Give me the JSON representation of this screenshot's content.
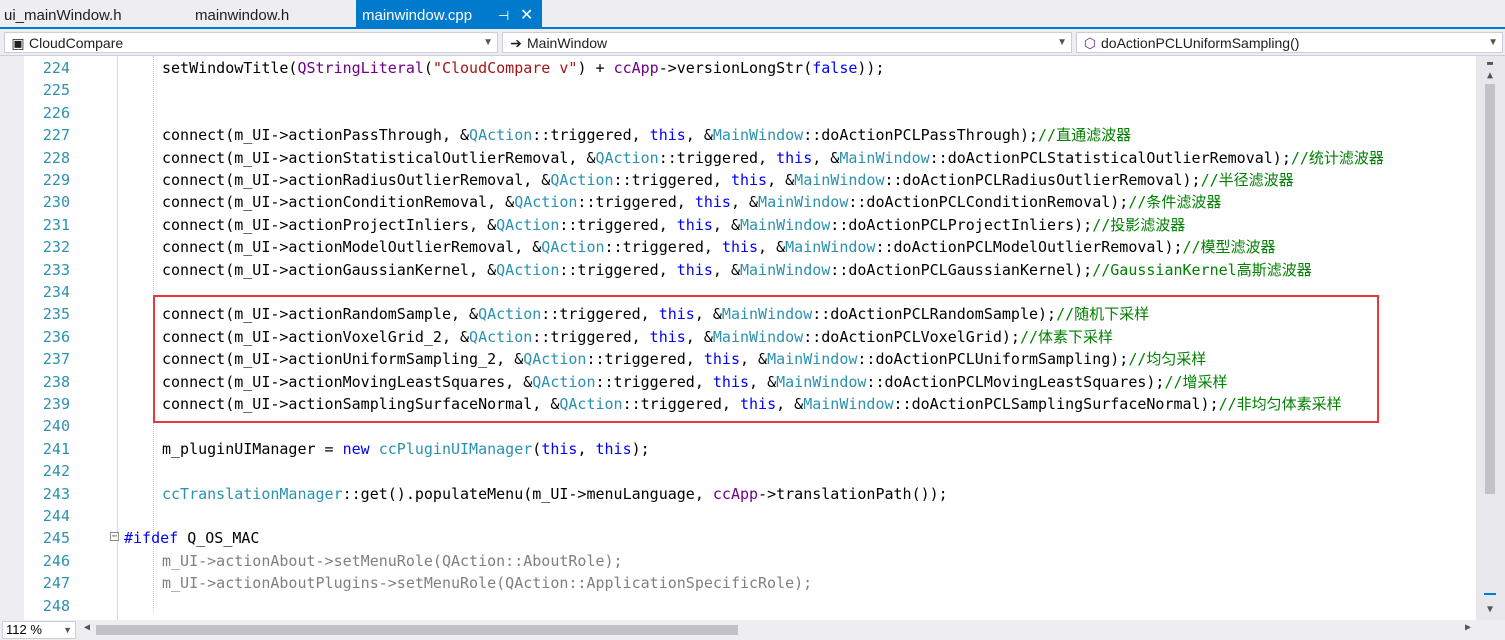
{
  "tabs": [
    {
      "label": "ui_mainWindow.h",
      "active": false
    },
    {
      "label": "mainwindow.h",
      "active": false
    },
    {
      "label": "mainwindow.cpp",
      "active": true
    }
  ],
  "tab_icons": {
    "pin": "pin-icon",
    "close": "close-icon"
  },
  "nav": {
    "project": "CloudCompare",
    "scope": "MainWindow",
    "member": "doActionPCLUniformSampling()"
  },
  "zoom": "112 %",
  "colors": {
    "accent": "#007acc",
    "line_number": "#2b91af",
    "keyword": "#0000ff",
    "type": "#2b91af",
    "macro": "#6f008a",
    "string": "#a31515",
    "comment": "#008000",
    "highlight_box": "#e8383d"
  },
  "code_lines": [
    {
      "n": "224",
      "segs": [
        [
          "p",
          "setWindowTitle("
        ],
        [
          "mc",
          "QStringLiteral"
        ],
        [
          "p",
          "("
        ],
        [
          "st",
          "\"CloudCompare v\""
        ],
        [
          "p",
          ") + "
        ],
        [
          "mc",
          "ccApp"
        ],
        [
          "p",
          "->versionLongStr("
        ],
        [
          "kw",
          "false"
        ],
        [
          "p",
          "));"
        ]
      ]
    },
    {
      "n": "225",
      "segs": []
    },
    {
      "n": "226",
      "segs": []
    },
    {
      "n": "227",
      "segs": [
        [
          "p",
          "connect(m_UI->actionPassThrough, &"
        ],
        [
          "ty",
          "QAction"
        ],
        [
          "p",
          "::triggered, "
        ],
        [
          "kw",
          "this"
        ],
        [
          "p",
          ", &"
        ],
        [
          "ty",
          "MainWindow"
        ],
        [
          "p",
          "::doActionPCLPassThrough);"
        ],
        [
          "cm",
          "//直通滤波器"
        ]
      ]
    },
    {
      "n": "228",
      "segs": [
        [
          "p",
          "connect(m_UI->actionStatisticalOutlierRemoval, &"
        ],
        [
          "ty",
          "QAction"
        ],
        [
          "p",
          "::triggered, "
        ],
        [
          "kw",
          "this"
        ],
        [
          "p",
          ", &"
        ],
        [
          "ty",
          "MainWindow"
        ],
        [
          "p",
          "::doActionPCLStatisticalOutlierRemoval);"
        ],
        [
          "cm",
          "//统计滤波器"
        ]
      ]
    },
    {
      "n": "229",
      "segs": [
        [
          "p",
          "connect(m_UI->actionRadiusOutlierRemoval, &"
        ],
        [
          "ty",
          "QAction"
        ],
        [
          "p",
          "::triggered, "
        ],
        [
          "kw",
          "this"
        ],
        [
          "p",
          ", &"
        ],
        [
          "ty",
          "MainWindow"
        ],
        [
          "p",
          "::doActionPCLRadiusOutlierRemoval);"
        ],
        [
          "cm",
          "//半径滤波器"
        ]
      ]
    },
    {
      "n": "230",
      "segs": [
        [
          "p",
          "connect(m_UI->actionConditionRemoval, &"
        ],
        [
          "ty",
          "QAction"
        ],
        [
          "p",
          "::triggered, "
        ],
        [
          "kw",
          "this"
        ],
        [
          "p",
          ", &"
        ],
        [
          "ty",
          "MainWindow"
        ],
        [
          "p",
          "::doActionPCLConditionRemoval);"
        ],
        [
          "cm",
          "//条件滤波器"
        ]
      ]
    },
    {
      "n": "231",
      "segs": [
        [
          "p",
          "connect(m_UI->actionProjectInliers, &"
        ],
        [
          "ty",
          "QAction"
        ],
        [
          "p",
          "::triggered, "
        ],
        [
          "kw",
          "this"
        ],
        [
          "p",
          ", &"
        ],
        [
          "ty",
          "MainWindow"
        ],
        [
          "p",
          "::doActionPCLProjectInliers);"
        ],
        [
          "cm",
          "//投影滤波器"
        ]
      ]
    },
    {
      "n": "232",
      "segs": [
        [
          "p",
          "connect(m_UI->actionModelOutlierRemoval, &"
        ],
        [
          "ty",
          "QAction"
        ],
        [
          "p",
          "::triggered, "
        ],
        [
          "kw",
          "this"
        ],
        [
          "p",
          ", &"
        ],
        [
          "ty",
          "MainWindow"
        ],
        [
          "p",
          "::doActionPCLModelOutlierRemoval);"
        ],
        [
          "cm",
          "//模型滤波器"
        ]
      ]
    },
    {
      "n": "233",
      "segs": [
        [
          "p",
          "connect(m_UI->actionGaussianKernel, &"
        ],
        [
          "ty",
          "QAction"
        ],
        [
          "p",
          "::triggered, "
        ],
        [
          "kw",
          "this"
        ],
        [
          "p",
          ", &"
        ],
        [
          "ty",
          "MainWindow"
        ],
        [
          "p",
          "::doActionPCLGaussianKernel);"
        ],
        [
          "cm",
          "//GaussianKernel高斯滤波器"
        ]
      ]
    },
    {
      "n": "234",
      "segs": []
    },
    {
      "n": "235",
      "segs": [
        [
          "p",
          "connect(m_UI->actionRandomSample, &"
        ],
        [
          "ty",
          "QAction"
        ],
        [
          "p",
          "::triggered, "
        ],
        [
          "kw",
          "this"
        ],
        [
          "p",
          ", &"
        ],
        [
          "ty",
          "MainWindow"
        ],
        [
          "p",
          "::doActionPCLRandomSample);"
        ],
        [
          "cm",
          "//随机下采样"
        ]
      ]
    },
    {
      "n": "236",
      "segs": [
        [
          "p",
          "connect(m_UI->actionVoxelGrid_2, &"
        ],
        [
          "ty",
          "QAction"
        ],
        [
          "p",
          "::triggered, "
        ],
        [
          "kw",
          "this"
        ],
        [
          "p",
          ", &"
        ],
        [
          "ty",
          "MainWindow"
        ],
        [
          "p",
          "::doActionPCLVoxelGrid);"
        ],
        [
          "cm",
          "//体素下采样"
        ]
      ]
    },
    {
      "n": "237",
      "segs": [
        [
          "p",
          "connect(m_UI->actionUniformSampling_2, &"
        ],
        [
          "ty",
          "QAction"
        ],
        [
          "p",
          "::triggered, "
        ],
        [
          "kw",
          "this"
        ],
        [
          "p",
          ", &"
        ],
        [
          "ty",
          "MainWindow"
        ],
        [
          "p",
          "::doActionPCLUniformSampling);"
        ],
        [
          "cm",
          "//均匀采样"
        ]
      ]
    },
    {
      "n": "238",
      "segs": [
        [
          "p",
          "connect(m_UI->actionMovingLeastSquares, &"
        ],
        [
          "ty",
          "QAction"
        ],
        [
          "p",
          "::triggered, "
        ],
        [
          "kw",
          "this"
        ],
        [
          "p",
          ", &"
        ],
        [
          "ty",
          "MainWindow"
        ],
        [
          "p",
          "::doActionPCLMovingLeastSquares);"
        ],
        [
          "cm",
          "//增采样"
        ]
      ]
    },
    {
      "n": "239",
      "segs": [
        [
          "p",
          "connect(m_UI->actionSamplingSurfaceNormal, &"
        ],
        [
          "ty",
          "QAction"
        ],
        [
          "p",
          "::triggered, "
        ],
        [
          "kw",
          "this"
        ],
        [
          "p",
          ", &"
        ],
        [
          "ty",
          "MainWindow"
        ],
        [
          "p",
          "::doActionPCLSamplingSurfaceNormal);"
        ],
        [
          "cm",
          "//非均匀体素采样"
        ]
      ]
    },
    {
      "n": "240",
      "segs": []
    },
    {
      "n": "241",
      "segs": [
        [
          "p",
          "m_pluginUIManager = "
        ],
        [
          "kw",
          "new"
        ],
        [
          "p",
          " "
        ],
        [
          "ty",
          "ccPluginUIManager"
        ],
        [
          "p",
          "("
        ],
        [
          "kw",
          "this"
        ],
        [
          "p",
          ", "
        ],
        [
          "kw",
          "this"
        ],
        [
          "p",
          ");"
        ]
      ]
    },
    {
      "n": "242",
      "segs": []
    },
    {
      "n": "243",
      "segs": [
        [
          "ty",
          "ccTranslationManager"
        ],
        [
          "p",
          "::get().populateMenu(m_UI->menuLanguage, "
        ],
        [
          "mc",
          "ccApp"
        ],
        [
          "p",
          "->translationPath());"
        ]
      ]
    },
    {
      "n": "244",
      "segs": []
    },
    {
      "n": "245",
      "pre": true,
      "segs": [
        [
          "kw",
          "#ifdef"
        ],
        [
          "p",
          " Q_OS_MAC"
        ]
      ]
    },
    {
      "n": "246",
      "segs": [
        [
          "gr",
          "m_UI->actionAbout->setMenuRole(QAction::AboutRole);"
        ]
      ]
    },
    {
      "n": "247",
      "segs": [
        [
          "gr",
          "m_UI->actionAboutPlugins->setMenuRole(QAction::ApplicationSpecificRole);"
        ]
      ]
    },
    {
      "n": "248",
      "segs": []
    }
  ]
}
